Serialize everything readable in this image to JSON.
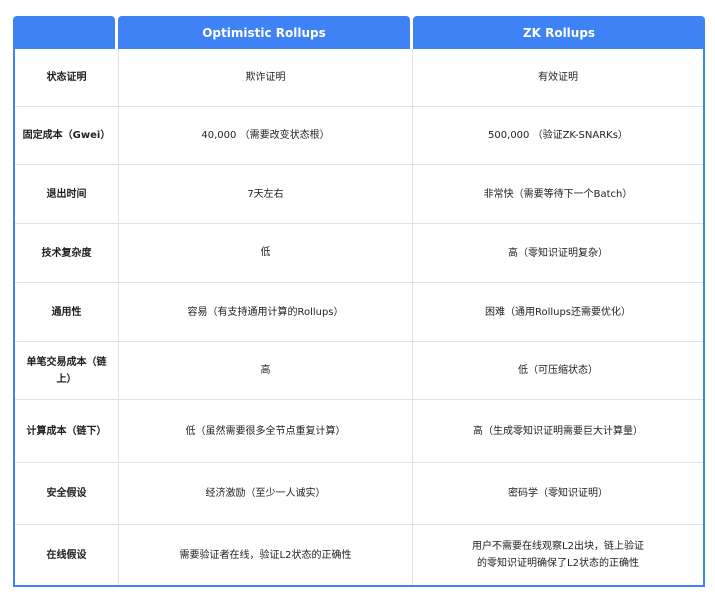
{
  "header": {
    "col0": "",
    "col1": "Optimistic Rollups",
    "col2": "ZK Rollups"
  },
  "rows": [
    {
      "label": "状态证明",
      "optimistic": "欺诈证明",
      "zk": "有效证明"
    },
    {
      "label": "固定成本（Gwei）",
      "optimistic": "40,000 （需要改变状态根）",
      "zk": "500,000 （验证ZK-SNARKs）"
    },
    {
      "label": "退出时间",
      "optimistic": "7天左右",
      "zk": "非常快（需要等待下一个Batch）"
    },
    {
      "label": "技术复杂度",
      "optimistic": "低",
      "zk": "高（零知识证明复杂）"
    },
    {
      "label": "通用性",
      "optimistic": "容易（有支持通用计算的Rollups）",
      "zk": "困难（通用Rollups还需要优化）"
    },
    {
      "label": "单笔交易成本（链上）",
      "optimistic": "高",
      "zk": "低（可压缩状态）"
    },
    {
      "label": "计算成本（链下）",
      "optimistic": "低（虽然需要很多全节点重复计算）",
      "zk": "高（生成零知识证明需要巨大计算量）"
    },
    {
      "label": "安全假设",
      "optimistic": "经济激励（至少一人诚实）",
      "zk": "密码学（零知识证明）"
    },
    {
      "label": "在线假设",
      "optimistic": "需要验证者在线，验证L2状态的正确性",
      "zk": "用户不需要在线观察L2出块，链上验证\n的零知识证明确保了L2状态的正确性"
    }
  ],
  "colors": {
    "header_bg": "#3e82f6",
    "header_text": "#ffffff",
    "border": "#3e82f6",
    "divider": "#e2e2e2"
  }
}
